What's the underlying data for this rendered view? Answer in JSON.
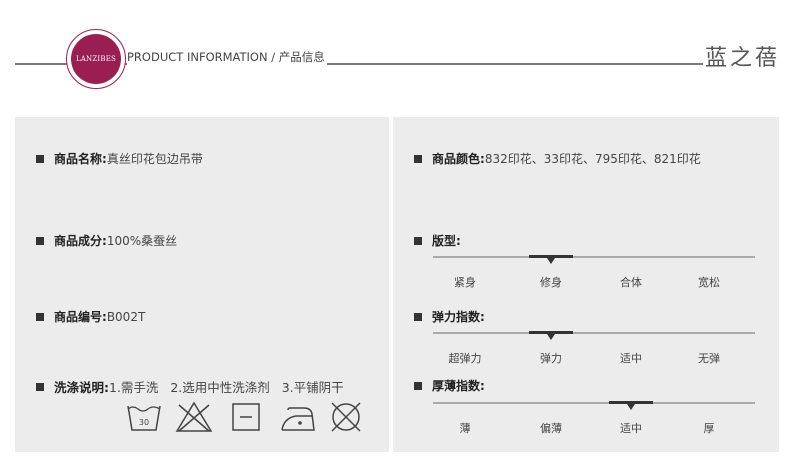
{
  "header": {
    "logo_text": "LANZIBES",
    "title": "PRODUCT  INFORMATION / 产品信息",
    "brand": "蓝之蓓"
  },
  "left": {
    "name": {
      "label": "商品名称:",
      "value": "真丝印花包边吊带"
    },
    "material": {
      "label": "商品成分:",
      "value": "100%桑蚕丝"
    },
    "code": {
      "label": "商品编号:",
      "value": "B002T"
    },
    "wash": {
      "label": "洗涤说明:",
      "value": "1.需手洗   2.选用中性洗涤剂   3.平铺阴干"
    }
  },
  "care_icons": [
    {
      "icon": "hand-wash-30-icon",
      "text": "30"
    },
    {
      "icon": "no-bleach-icon"
    },
    {
      "icon": "flat-dry-icon"
    },
    {
      "icon": "iron-low-icon"
    },
    {
      "icon": "no-dry-clean-icon"
    }
  ],
  "right": {
    "color": {
      "label": "商品颜色:",
      "value": "832印花、33印花、795印花、821印花"
    },
    "fit": {
      "label": "版型:",
      "options": [
        "紧身",
        "修身",
        "合体",
        "宽松"
      ],
      "selected": 1
    },
    "elastic": {
      "label": "弹力指数:",
      "options": [
        "超弹力",
        "弹力",
        "适中",
        "无弹"
      ],
      "selected": 1
    },
    "thickness": {
      "label": "厚薄指数:",
      "options": [
        "薄",
        "偏薄",
        "适中",
        "厚"
      ],
      "selected": 2
    }
  },
  "colors": {
    "accent": "#9b1e52",
    "panel": "#ececec",
    "marker": "#333333"
  }
}
